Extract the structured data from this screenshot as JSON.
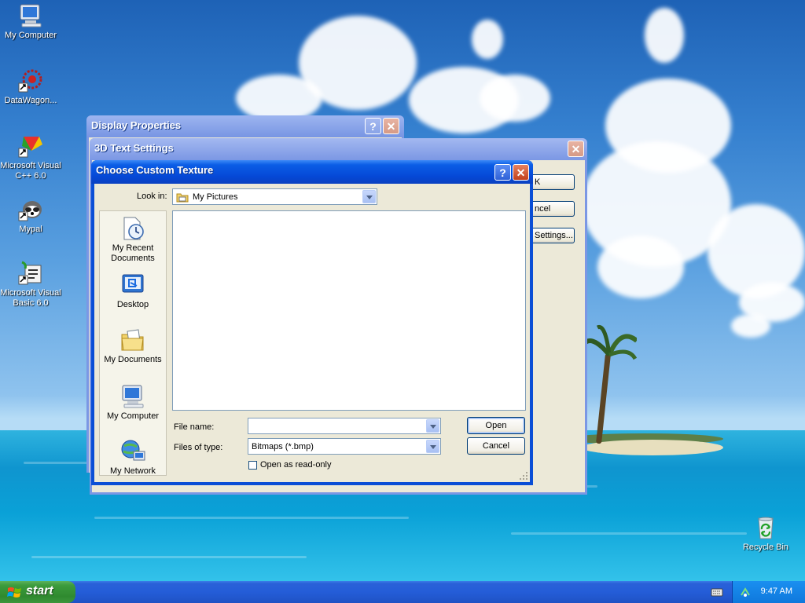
{
  "desktop": {
    "icons": [
      {
        "label": "My Computer",
        "icon": "computer-icon"
      },
      {
        "label": "DataWagon...",
        "icon": "datawagon-icon"
      },
      {
        "label": "Microsoft Visual C++ 6.0",
        "icon": "visual-cpp-icon"
      },
      {
        "label": "Mypal",
        "icon": "mypal-icon"
      },
      {
        "label": "Microsoft Visual Basic 6.0",
        "icon": "visual-basic-icon"
      },
      {
        "label": "Recycle Bin",
        "icon": "recycle-bin-icon"
      }
    ]
  },
  "windows": {
    "display_properties": {
      "title": "Display Properties"
    },
    "text3d_settings": {
      "title": "3D Text Settings",
      "buttons": {
        "ok": "K",
        "cancel": "ncel",
        "settings": "Settings..."
      }
    },
    "choose_texture": {
      "title": "Choose Custom Texture",
      "look_in_label": "Look in:",
      "look_in_value": "My Pictures",
      "places": [
        "My Recent Documents",
        "Desktop",
        "My Documents",
        "My Computer",
        "My Network"
      ],
      "file_name_label": "File name:",
      "file_name_value": "",
      "files_of_type_label": "Files of type:",
      "files_of_type_value": "Bitmaps (*.bmp)",
      "open_button": "Open",
      "cancel_button": "Cancel",
      "readonly_label": "Open as read-only",
      "readonly_checked": false
    }
  },
  "taskbar": {
    "start_label": "start",
    "clock": "9:47 AM"
  },
  "colors": {
    "xp_blue": "#0a4ed6",
    "start_green": "#3c9b3c",
    "close_red": "#c2401c"
  }
}
